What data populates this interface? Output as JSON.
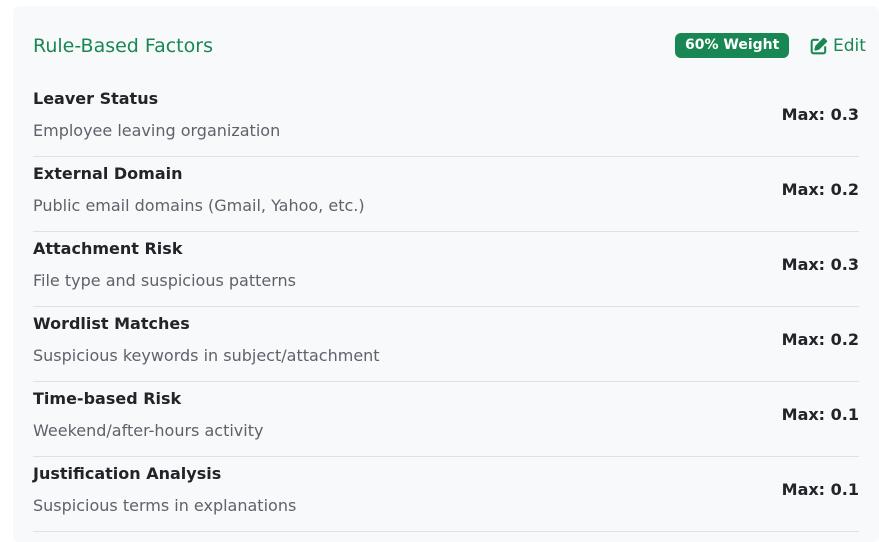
{
  "header": {
    "title": "Rule-Based Factors",
    "weight_badge": "60% Weight",
    "edit_label": "Edit"
  },
  "icons": {
    "edit": "pencil-square-icon"
  },
  "colors": {
    "accent": "#198754",
    "card_background": "#f8f9fa",
    "muted_text": "#5c636a",
    "divider": "#dee2e6"
  },
  "factors": [
    {
      "name": "Leaver Status",
      "description": "Employee leaving organization",
      "max": "Max: 0.3"
    },
    {
      "name": "External Domain",
      "description": "Public email domains (Gmail, Yahoo, etc.)",
      "max": "Max: 0.2"
    },
    {
      "name": "Attachment Risk",
      "description": "File type and suspicious patterns",
      "max": "Max: 0.3"
    },
    {
      "name": "Wordlist Matches",
      "description": "Suspicious keywords in subject/attachment",
      "max": "Max: 0.2"
    },
    {
      "name": "Time-based Risk",
      "description": "Weekend/after-hours activity",
      "max": "Max: 0.1"
    },
    {
      "name": "Justification Analysis",
      "description": "Suspicious terms in explanations",
      "max": "Max: 0.1"
    }
  ]
}
